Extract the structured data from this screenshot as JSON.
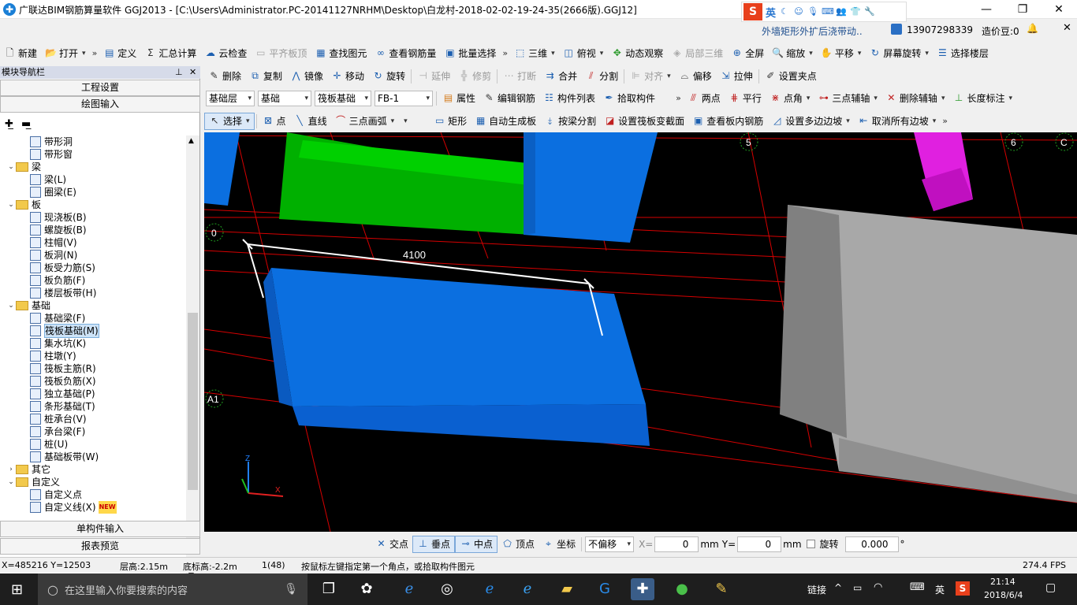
{
  "titlebar": {
    "title": "广联达BIM钢筋算量软件 GGJ2013 - [C:\\Users\\Administrator.PC-20141127NRHM\\Desktop\\白龙村-2018-02-02-19-24-35(2666版).GGJ12]",
    "minimize": "—",
    "restore": "❐",
    "close": "✕"
  },
  "ime": {
    "logo": "S",
    "lang": "英",
    "icons": [
      "moon-icon",
      "smiley-icon",
      "microphone-icon",
      "keyboard-icon",
      "users-icon",
      "shirt-icon",
      "wrench-icon"
    ]
  },
  "userbar": {
    "notice": "外墙矩形外扩后浇带动..",
    "phone": "13907298339",
    "points": "造价豆:0"
  },
  "toolbar1": {
    "items": [
      {
        "label": "新建",
        "icon": "new-file-icon"
      },
      {
        "label": "打开",
        "icon": "open-folder-icon",
        "dropdown": true
      },
      {
        "label": "定义",
        "icon": "define-icon"
      },
      {
        "label": "汇总计算",
        "icon": "sigma-icon"
      },
      {
        "label": "云检查",
        "icon": "cloud-check-icon"
      },
      {
        "label": "平齐板顶",
        "icon": "align-top-icon",
        "disabled": true
      },
      {
        "label": "查找图元",
        "icon": "find-icon"
      },
      {
        "label": "查看钢筋量",
        "icon": "rebar-qty-icon"
      },
      {
        "label": "批量选择",
        "icon": "batch-select-icon"
      },
      {
        "label": "三维",
        "icon": "3d-icon",
        "dropdown": true
      },
      {
        "label": "俯视",
        "icon": "top-view-icon",
        "dropdown": true
      },
      {
        "label": "动态观察",
        "icon": "orbit-icon"
      },
      {
        "label": "局部三维",
        "icon": "local-3d-icon",
        "disabled": true
      },
      {
        "label": "全屏",
        "icon": "fullscreen-icon"
      },
      {
        "label": "缩放",
        "icon": "zoom-icon",
        "dropdown": true
      },
      {
        "label": "平移",
        "icon": "pan-icon",
        "dropdown": true
      },
      {
        "label": "屏幕旋转",
        "icon": "screen-rotate-icon",
        "dropdown": true
      },
      {
        "label": "选择楼层",
        "icon": "floor-select-icon"
      }
    ]
  },
  "toolbar2": {
    "items": [
      {
        "label": "删除",
        "icon": "delete-icon"
      },
      {
        "label": "复制",
        "icon": "copy-icon"
      },
      {
        "label": "镜像",
        "icon": "mirror-icon"
      },
      {
        "label": "移动",
        "icon": "move-icon"
      },
      {
        "label": "旋转",
        "icon": "rotate-icon"
      },
      {
        "label": "延伸",
        "icon": "extend-icon",
        "disabled": true
      },
      {
        "label": "修剪",
        "icon": "trim-icon",
        "disabled": true
      },
      {
        "label": "打断",
        "icon": "break-icon",
        "disabled": true
      },
      {
        "label": "合并",
        "icon": "merge-icon"
      },
      {
        "label": "分割",
        "icon": "split-icon"
      },
      {
        "label": "对齐",
        "icon": "align-icon",
        "disabled": true,
        "dropdown": true
      },
      {
        "label": "偏移",
        "icon": "offset-icon"
      },
      {
        "label": "拉伸",
        "icon": "stretch-icon"
      },
      {
        "label": "设置夹点",
        "icon": "grip-icon"
      }
    ]
  },
  "toolbar3": {
    "floor": "基础层",
    "category": "基础",
    "type": "筏板基础",
    "component": "FB-1",
    "items": [
      {
        "label": "属性",
        "icon": "properties-icon"
      },
      {
        "label": "编辑钢筋",
        "icon": "edit-rebar-icon"
      },
      {
        "label": "构件列表",
        "icon": "component-list-icon"
      },
      {
        "label": "拾取构件",
        "icon": "pick-component-icon"
      },
      {
        "label": "两点",
        "icon": "two-point-icon"
      },
      {
        "label": "平行",
        "icon": "parallel-icon"
      },
      {
        "label": "点角",
        "icon": "point-angle-icon",
        "dropdown": true
      },
      {
        "label": "三点辅轴",
        "icon": "three-point-axis-icon",
        "dropdown": true
      },
      {
        "label": "删除辅轴",
        "icon": "delete-axis-icon",
        "dropdown": true
      },
      {
        "label": "长度标注",
        "icon": "length-dim-icon",
        "dropdown": true
      }
    ]
  },
  "toolbar4": {
    "items": [
      {
        "label": "选择",
        "icon": "cursor-icon",
        "dropdown": true,
        "selected": true
      },
      {
        "label": "点",
        "icon": "point-icon"
      },
      {
        "label": "直线",
        "icon": "line-icon"
      },
      {
        "label": "三点画弧",
        "icon": "arc-icon",
        "dropdown": true
      },
      {
        "label": "矩形",
        "icon": "rectangle-icon"
      },
      {
        "label": "自动生成板",
        "icon": "auto-slab-icon"
      },
      {
        "label": "按梁分割",
        "icon": "beam-split-icon"
      },
      {
        "label": "设置筏板变截面",
        "icon": "variable-section-icon"
      },
      {
        "label": "查看板内钢筋",
        "icon": "view-slab-rebar-icon"
      },
      {
        "label": "设置多边边坡",
        "icon": "slope-icon",
        "dropdown": true
      },
      {
        "label": "取消所有边坡",
        "icon": "cancel-slope-icon",
        "dropdown": true
      }
    ]
  },
  "panel": {
    "header": "模块导航栏",
    "pin": "📌",
    "close": "✕",
    "btn_settings": "工程设置",
    "btn_drawing": "绘图输入",
    "btn_single": "单构件输入",
    "btn_report": "报表预览",
    "tree": [
      {
        "level": 2,
        "label": "带形洞",
        "icon": "strip-hole-icon"
      },
      {
        "level": 2,
        "label": "带形窗",
        "icon": "strip-window-icon"
      },
      {
        "level": 1,
        "label": "梁",
        "folder": true,
        "expanded": true
      },
      {
        "level": 2,
        "label": "梁(L)",
        "icon": "beam-icon"
      },
      {
        "level": 2,
        "label": "圈梁(E)",
        "icon": "ring-beam-icon"
      },
      {
        "level": 1,
        "label": "板",
        "folder": true,
        "expanded": true
      },
      {
        "level": 2,
        "label": "现浇板(B)",
        "icon": "cast-slab-icon"
      },
      {
        "level": 2,
        "label": "螺旋板(B)",
        "icon": "spiral-slab-icon"
      },
      {
        "level": 2,
        "label": "柱帽(V)",
        "icon": "column-cap-icon"
      },
      {
        "level": 2,
        "label": "板洞(N)",
        "icon": "slab-hole-icon"
      },
      {
        "level": 2,
        "label": "板受力筋(S)",
        "icon": "slab-rebar-icon"
      },
      {
        "level": 2,
        "label": "板负筋(F)",
        "icon": "slab-neg-rebar-icon"
      },
      {
        "level": 2,
        "label": "楼层板带(H)",
        "icon": "floor-strip-icon"
      },
      {
        "level": 1,
        "label": "基础",
        "folder": true,
        "expanded": true
      },
      {
        "level": 2,
        "label": "基础梁(F)",
        "icon": "foundation-beam-icon"
      },
      {
        "level": 2,
        "label": "筏板基础(M)",
        "icon": "raft-foundation-icon",
        "selected": true
      },
      {
        "level": 2,
        "label": "集水坑(K)",
        "icon": "sump-icon"
      },
      {
        "level": 2,
        "label": "柱墩(Y)",
        "icon": "column-pier-icon"
      },
      {
        "level": 2,
        "label": "筏板主筋(R)",
        "icon": "raft-main-rebar-icon"
      },
      {
        "level": 2,
        "label": "筏板负筋(X)",
        "icon": "raft-neg-rebar-icon"
      },
      {
        "level": 2,
        "label": "独立基础(P)",
        "icon": "isolated-foundation-icon"
      },
      {
        "level": 2,
        "label": "条形基础(T)",
        "icon": "strip-foundation-icon"
      },
      {
        "level": 2,
        "label": "桩承台(V)",
        "icon": "pile-cap-icon"
      },
      {
        "level": 2,
        "label": "承台梁(F)",
        "icon": "cap-beam-icon"
      },
      {
        "level": 2,
        "label": "桩(U)",
        "icon": "pile-icon"
      },
      {
        "level": 2,
        "label": "基础板带(W)",
        "icon": "foundation-strip-icon"
      },
      {
        "level": 1,
        "label": "其它",
        "folder": true,
        "expanded": false
      },
      {
        "level": 1,
        "label": "自定义",
        "folder": true,
        "expanded": true
      },
      {
        "level": 2,
        "label": "自定义点",
        "icon": "custom-point-icon"
      },
      {
        "level": 2,
        "label": "自定义线(X)",
        "icon": "custom-line-icon",
        "badge": "NEW"
      }
    ]
  },
  "viewport": {
    "dimension": "4100",
    "axis_labels": {
      "left_top": "0",
      "left_bottom": "A1",
      "top_5": "5",
      "top_6": "6",
      "top_c": "C"
    },
    "colors": {
      "bg": "#000000",
      "grid": "#e00000",
      "blue": "#0b6fe0",
      "green": "#00c000",
      "gray": "#a8a8a8",
      "magenta": "#e020e0"
    }
  },
  "snapbar": {
    "items": [
      {
        "label": "交点",
        "icon": "intersect-icon"
      },
      {
        "label": "垂点",
        "icon": "perpendicular-icon",
        "selected": true
      },
      {
        "label": "中点",
        "icon": "midpoint-icon",
        "selected": true
      },
      {
        "label": "顶点",
        "icon": "vertex-icon"
      },
      {
        "label": "坐标",
        "icon": "coordinate-icon"
      }
    ],
    "offset": "不偏移",
    "x_label": "X=",
    "x_value": "0",
    "unit": "mm",
    "y_label": "Y=",
    "y_value": "0",
    "rotate_label": "旋转",
    "rotate_value": "0.000",
    "degree": "°"
  },
  "status": {
    "coords": "X=485216  Y=12503",
    "floor_height": "层高:2.15m",
    "bottom_height": "底标高:-2.2m",
    "count": "1(48)",
    "hint": "按鼠标左键指定第一个角点，或拾取构件图元",
    "fps": "274.4 FPS"
  },
  "taskbar": {
    "search_placeholder": "在这里输入你要搜索的内容",
    "tray_link": "链接",
    "tray_lang": "英",
    "time": "21:14",
    "date": "2018/6/4"
  }
}
